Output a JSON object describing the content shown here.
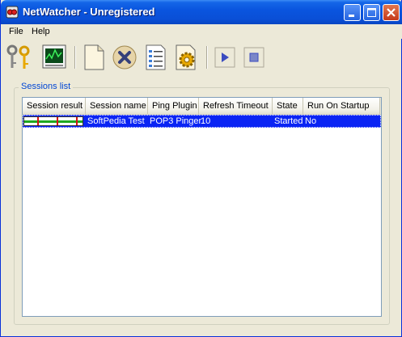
{
  "window": {
    "title": "NetWatcher - Unregistered",
    "title_bar_color": "#0a55df"
  },
  "menu": {
    "file": "File",
    "help": "Help"
  },
  "toolbar": {
    "icons": [
      "keys-icon",
      "monitor-chart-icon",
      "new-document-icon",
      "delete-icon",
      "properties-document-icon",
      "settings-gear-icon",
      "play-icon",
      "stop-icon"
    ]
  },
  "sessions": {
    "label": "Sessions list",
    "columns": [
      "Session result",
      "Session name",
      "Ping Plugin",
      "Refresh Timeout",
      "State",
      "Run On Startup"
    ],
    "rows": [
      {
        "session_name": "SoftPedia Test",
        "ping_plugin": "POP3 Pinger",
        "refresh_timeout": "10",
        "state": "Started",
        "run_on_startup": "No",
        "selected": true
      }
    ],
    "selection_color": "#0a24f4"
  }
}
